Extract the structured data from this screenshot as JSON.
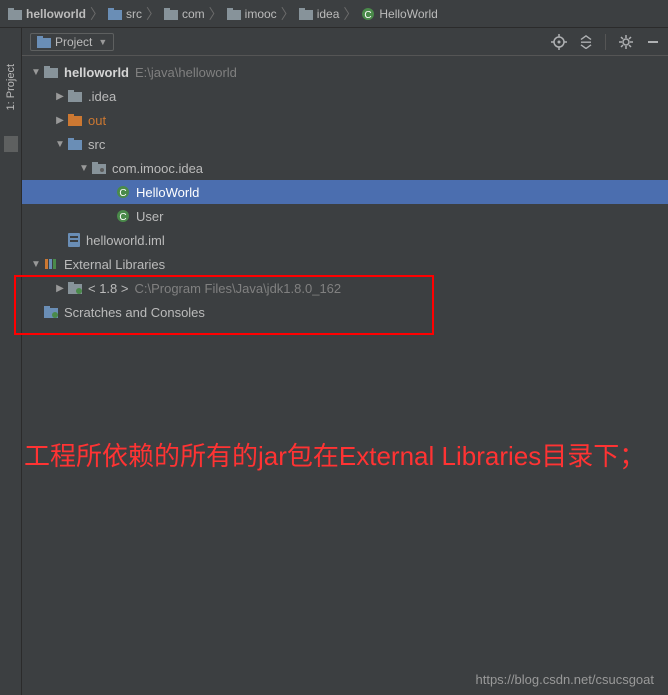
{
  "breadcrumbs": [
    {
      "label": "helloworld",
      "icon": "folder"
    },
    {
      "label": "src",
      "icon": "folder"
    },
    {
      "label": "com",
      "icon": "folder"
    },
    {
      "label": "imooc",
      "icon": "folder"
    },
    {
      "label": "idea",
      "icon": "folder"
    },
    {
      "label": "HelloWorld",
      "icon": "class"
    }
  ],
  "panel": {
    "title": "Project"
  },
  "tool_window": {
    "label": "1: Project"
  },
  "tree": {
    "root": {
      "label": "helloworld",
      "path": "E:\\java\\helloworld"
    },
    "idea_folder": ".idea",
    "out_folder": "out",
    "src_folder": "src",
    "package": "com.imooc.idea",
    "class1": "HelloWorld",
    "class2": "User",
    "iml": "helloworld.iml",
    "ext_lib": "External Libraries",
    "jdk": {
      "label": "< 1.8 >",
      "path": "C:\\Program Files\\Java\\jdk1.8.0_162"
    },
    "scratches": "Scratches and Consoles"
  },
  "annotation": "工程所依赖的所有的jar包在External Libraries目录下；",
  "watermark": "https://blog.csdn.net/csucsgoat"
}
